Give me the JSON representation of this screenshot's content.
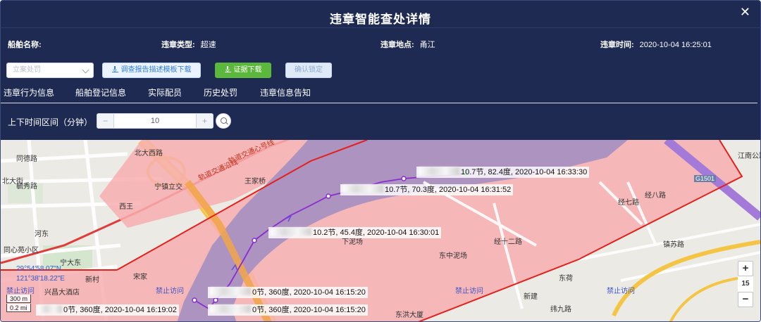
{
  "dialog": {
    "title": "违章智能查处详情",
    "close_glyph": "✕"
  },
  "info": {
    "ship_name_label": "船舶名称:",
    "ship_name_value": "",
    "type_label": "违章类型:",
    "type_value": "超速",
    "location_label": "违章地点:",
    "location_value": "甬江",
    "time_label": "违章时间:",
    "time_value": "2020-10-04 16:25:01"
  },
  "toolbar": {
    "select_placeholder": "立案处罚",
    "template_download_label": "调查报告描述模板下载",
    "evidence_download_label": "证据下载",
    "confirm_label": "确认锁定"
  },
  "tabs": [
    {
      "label": "违章行为信息",
      "active": true
    },
    {
      "label": "船舶登记信息"
    },
    {
      "label": "实际配员"
    },
    {
      "label": "历史处罚"
    },
    {
      "label": "违章信息告知"
    }
  ],
  "filter": {
    "range_label": "上下时间区间（分钟）",
    "minus": "−",
    "plus": "+",
    "value": "10"
  },
  "map": {
    "place_labels": [
      "同德路",
      "北大街",
      "毓秀路",
      "西王",
      "河东",
      "同心苑小区",
      "宁大东",
      "新村",
      "宋家",
      "兴昌大酒店",
      "宁镇立交",
      "王家桥",
      "下泥场",
      "东中泥场",
      "经七路",
      "经八路",
      "经十二路",
      "东荷",
      "新建",
      "纬九路",
      "镇苏路",
      "江南公路",
      "北大西路",
      "东洪大厦"
    ],
    "road_labels": [
      "轨道交通沿线",
      "轨道交通心号线"
    ],
    "forbidden_labels": [
      "禁止访问",
      "禁止访问",
      "禁止访问",
      "禁止访问"
    ],
    "highway_label": "G1501",
    "coordinates": [
      "29°54'58.07\"N",
      "121°38'18.22\"E"
    ],
    "scale": [
      "300 m",
      "0.2 mi"
    ],
    "track_tips": [
      {
        "value": "10.7节, 82.4度, 2020-10-04 16:33:30"
      },
      {
        "value": "10.7节, 70.3度, 2020-10-04 16:31:52"
      },
      {
        "value": "10.2节, 45.4度, 2020-10-04 16:30:01"
      },
      {
        "value": "0节, 360度, 2020-10-04 16:15:20"
      },
      {
        "value": "0节, 360度, 2020-10-04 16:15:20"
      },
      {
        "value": "0节, 360度, 2020-10-04 16:19:02"
      }
    ],
    "zoom_in": "+",
    "zoom_level": "15",
    "zoom_out": "−"
  },
  "colors": {
    "dialog_bg": "#1e2a52",
    "accent_blue": "#2f7de1",
    "accent_green": "#5cb83c",
    "zone_fill": "#f7aeb0",
    "zone_border": "#e4201c",
    "river": "#ad93bf",
    "track": "#8b2bd0"
  }
}
